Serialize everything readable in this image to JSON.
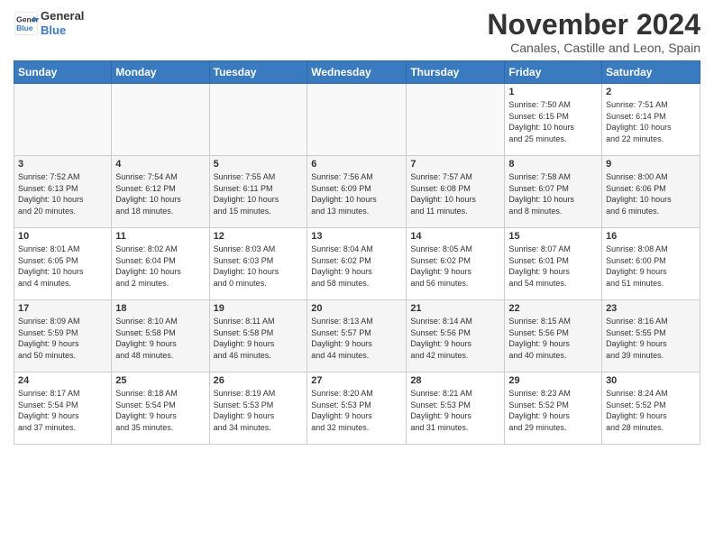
{
  "header": {
    "logo_line1": "General",
    "logo_line2": "Blue",
    "month": "November 2024",
    "location": "Canales, Castille and Leon, Spain"
  },
  "weekdays": [
    "Sunday",
    "Monday",
    "Tuesday",
    "Wednesday",
    "Thursday",
    "Friday",
    "Saturday"
  ],
  "weeks": [
    [
      {
        "day": "",
        "info": ""
      },
      {
        "day": "",
        "info": ""
      },
      {
        "day": "",
        "info": ""
      },
      {
        "day": "",
        "info": ""
      },
      {
        "day": "",
        "info": ""
      },
      {
        "day": "1",
        "info": "Sunrise: 7:50 AM\nSunset: 6:15 PM\nDaylight: 10 hours\nand 25 minutes."
      },
      {
        "day": "2",
        "info": "Sunrise: 7:51 AM\nSunset: 6:14 PM\nDaylight: 10 hours\nand 22 minutes."
      }
    ],
    [
      {
        "day": "3",
        "info": "Sunrise: 7:52 AM\nSunset: 6:13 PM\nDaylight: 10 hours\nand 20 minutes."
      },
      {
        "day": "4",
        "info": "Sunrise: 7:54 AM\nSunset: 6:12 PM\nDaylight: 10 hours\nand 18 minutes."
      },
      {
        "day": "5",
        "info": "Sunrise: 7:55 AM\nSunset: 6:11 PM\nDaylight: 10 hours\nand 15 minutes."
      },
      {
        "day": "6",
        "info": "Sunrise: 7:56 AM\nSunset: 6:09 PM\nDaylight: 10 hours\nand 13 minutes."
      },
      {
        "day": "7",
        "info": "Sunrise: 7:57 AM\nSunset: 6:08 PM\nDaylight: 10 hours\nand 11 minutes."
      },
      {
        "day": "8",
        "info": "Sunrise: 7:58 AM\nSunset: 6:07 PM\nDaylight: 10 hours\nand 8 minutes."
      },
      {
        "day": "9",
        "info": "Sunrise: 8:00 AM\nSunset: 6:06 PM\nDaylight: 10 hours\nand 6 minutes."
      }
    ],
    [
      {
        "day": "10",
        "info": "Sunrise: 8:01 AM\nSunset: 6:05 PM\nDaylight: 10 hours\nand 4 minutes."
      },
      {
        "day": "11",
        "info": "Sunrise: 8:02 AM\nSunset: 6:04 PM\nDaylight: 10 hours\nand 2 minutes."
      },
      {
        "day": "12",
        "info": "Sunrise: 8:03 AM\nSunset: 6:03 PM\nDaylight: 10 hours\nand 0 minutes."
      },
      {
        "day": "13",
        "info": "Sunrise: 8:04 AM\nSunset: 6:02 PM\nDaylight: 9 hours\nand 58 minutes."
      },
      {
        "day": "14",
        "info": "Sunrise: 8:05 AM\nSunset: 6:02 PM\nDaylight: 9 hours\nand 56 minutes."
      },
      {
        "day": "15",
        "info": "Sunrise: 8:07 AM\nSunset: 6:01 PM\nDaylight: 9 hours\nand 54 minutes."
      },
      {
        "day": "16",
        "info": "Sunrise: 8:08 AM\nSunset: 6:00 PM\nDaylight: 9 hours\nand 51 minutes."
      }
    ],
    [
      {
        "day": "17",
        "info": "Sunrise: 8:09 AM\nSunset: 5:59 PM\nDaylight: 9 hours\nand 50 minutes."
      },
      {
        "day": "18",
        "info": "Sunrise: 8:10 AM\nSunset: 5:58 PM\nDaylight: 9 hours\nand 48 minutes."
      },
      {
        "day": "19",
        "info": "Sunrise: 8:11 AM\nSunset: 5:58 PM\nDaylight: 9 hours\nand 46 minutes."
      },
      {
        "day": "20",
        "info": "Sunrise: 8:13 AM\nSunset: 5:57 PM\nDaylight: 9 hours\nand 44 minutes."
      },
      {
        "day": "21",
        "info": "Sunrise: 8:14 AM\nSunset: 5:56 PM\nDaylight: 9 hours\nand 42 minutes."
      },
      {
        "day": "22",
        "info": "Sunrise: 8:15 AM\nSunset: 5:56 PM\nDaylight: 9 hours\nand 40 minutes."
      },
      {
        "day": "23",
        "info": "Sunrise: 8:16 AM\nSunset: 5:55 PM\nDaylight: 9 hours\nand 39 minutes."
      }
    ],
    [
      {
        "day": "24",
        "info": "Sunrise: 8:17 AM\nSunset: 5:54 PM\nDaylight: 9 hours\nand 37 minutes."
      },
      {
        "day": "25",
        "info": "Sunrise: 8:18 AM\nSunset: 5:54 PM\nDaylight: 9 hours\nand 35 minutes."
      },
      {
        "day": "26",
        "info": "Sunrise: 8:19 AM\nSunset: 5:53 PM\nDaylight: 9 hours\nand 34 minutes."
      },
      {
        "day": "27",
        "info": "Sunrise: 8:20 AM\nSunset: 5:53 PM\nDaylight: 9 hours\nand 32 minutes."
      },
      {
        "day": "28",
        "info": "Sunrise: 8:21 AM\nSunset: 5:53 PM\nDaylight: 9 hours\nand 31 minutes."
      },
      {
        "day": "29",
        "info": "Sunrise: 8:23 AM\nSunset: 5:52 PM\nDaylight: 9 hours\nand 29 minutes."
      },
      {
        "day": "30",
        "info": "Sunrise: 8:24 AM\nSunset: 5:52 PM\nDaylight: 9 hours\nand 28 minutes."
      }
    ]
  ]
}
